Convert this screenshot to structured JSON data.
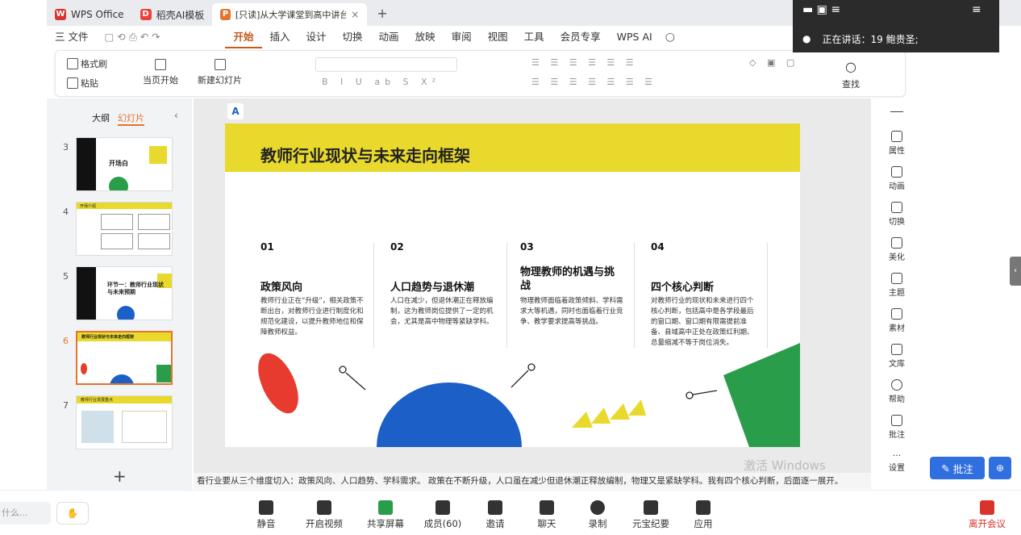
{
  "tabs": [
    {
      "label": "WPS Office",
      "icon": "wps-logo-icon",
      "color": "#d9342b"
    },
    {
      "label": "稻壳AI模板",
      "icon": "docer-icon",
      "color": "#e9423a"
    },
    {
      "label": "[只读]从大学课堂到高中讲台──",
      "icon": "presentation-icon",
      "color": "#e5742c"
    }
  ],
  "menus": [
    "三 文件",
    "开始",
    "插入",
    "设计",
    "切换",
    "动画",
    "放映",
    "审阅",
    "视图",
    "工具",
    "会员专享",
    "WPS AI"
  ],
  "ribbon": {
    "format_painter": "格式刷",
    "paste": "粘贴",
    "play_from_current": "当页开始",
    "new_slide": "新建幻灯片",
    "find": "查找"
  },
  "leftpane": {
    "tab_outline": "大纲",
    "tab_slides": "幻灯片",
    "thumbs": [
      {
        "num": "3",
        "title": "开场白"
      },
      {
        "num": "4",
        "title": "开场介绍"
      },
      {
        "num": "5",
        "title": "环节一：教师行业现状与未来预期"
      },
      {
        "num": "6",
        "title": "教师行业现状与未来走向框架"
      },
      {
        "num": "7",
        "title": "教师行业发展重点"
      }
    ],
    "add": "+"
  },
  "slide": {
    "title": "教师行业现状与未来走向框架",
    "cols": [
      {
        "num": "01",
        "title": "政策风向",
        "text": "教师行业正在“升级”，相关政策不断出台，对教师行业进行制度化和规范化建设，以提升教师地位和保障教师权益。"
      },
      {
        "num": "02",
        "title": "人口趋势与退休潮",
        "text": "人口在减少，但退休潮正在释放编制，这为教师岗位提供了一定的机会，尤其是高中物理等紧缺学科。"
      },
      {
        "num": "03",
        "title": "物理教师的机遇与挑战",
        "text": "物理教师面临着政策倾斜、学科需求大等机遇，同时也面临着行业竞争、教学要求提高等挑战。"
      },
      {
        "num": "04",
        "title": "四个核心判断",
        "text": "对教师行业的现状和未来进行四个核心判断，包括高中是各学段最后的窗口期、窗口期有限需提前准备、县域高中正处在政策红利期、总量缩减不等于岗位消失。"
      }
    ]
  },
  "notes": "看行业要从三个维度切入：政策风向、人口趋势、学科需求。 政策在不断升级，人口虽在减少但退休潮正释放编制，物理又是紧缺学科。我有四个核心判断，后面逐一展开。",
  "watermark": "激活 Windows",
  "rightbar": [
    {
      "label": "属性",
      "icon": "properties-icon"
    },
    {
      "label": "动画",
      "icon": "animation-icon"
    },
    {
      "label": "切换",
      "icon": "transition-icon"
    },
    {
      "label": "美化",
      "icon": "beautify-icon"
    },
    {
      "label": "主题",
      "icon": "theme-icon"
    },
    {
      "label": "素材",
      "icon": "assets-icon"
    },
    {
      "label": "文库",
      "icon": "library-icon"
    },
    {
      "label": "帮助",
      "icon": "help-icon"
    },
    {
      "label": "批注",
      "icon": "comment-icon"
    },
    {
      "label": "设置",
      "icon": "settings-icon"
    }
  ],
  "annotate_btn": "批注",
  "meeting": {
    "speaking": "正在讲话：19 鲍贵圣;"
  },
  "bottombar": {
    "input_placeholder": "什么...",
    "items": [
      "静音",
      "开启视频",
      "共享屏幕",
      "成员(60)",
      "邀请",
      "聊天",
      "录制",
      "元宝纪要",
      "应用"
    ],
    "leave": "离开会议"
  }
}
